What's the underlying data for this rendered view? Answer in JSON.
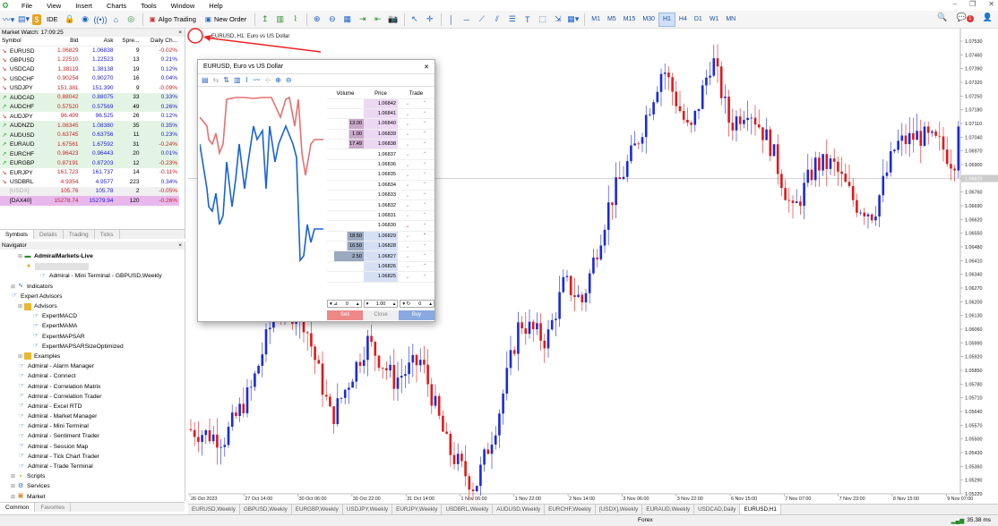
{
  "menu": [
    "File",
    "View",
    "Insert",
    "Charts",
    "Tools",
    "Window",
    "Help"
  ],
  "toolbar": {
    "ide": "IDE",
    "algo": "Algo Trading",
    "neworder": "New Order",
    "timeframes": [
      "M1",
      "M5",
      "M15",
      "M30",
      "H1",
      "H4",
      "D1",
      "W1",
      "MN"
    ],
    "active_tf": "H1",
    "notif_count": "1"
  },
  "market_watch": {
    "title": "Market Watch: 17:09:25",
    "headers": [
      "Symbol",
      "Bid",
      "Ask",
      "Spre...",
      "Daily Ch..."
    ],
    "rows": [
      {
        "dir": "down",
        "sym": "EURUSD",
        "bid": "1.06829",
        "ask": "1.06838",
        "spread": "9",
        "chg": "-0.02%",
        "bg": "#ffffff"
      },
      {
        "dir": "down",
        "sym": "GBPUSD",
        "bid": "1.22510",
        "ask": "1.22523",
        "spread": "13",
        "chg": "0.21%",
        "bg": "#ffffff"
      },
      {
        "dir": "down",
        "sym": "USDCAD",
        "bid": "1.38119",
        "ask": "1.38138",
        "spread": "19",
        "chg": "0.12%",
        "bg": "#ffffff"
      },
      {
        "dir": "down",
        "sym": "USDCHF",
        "bid": "0.90254",
        "ask": "0.90270",
        "spread": "16",
        "chg": "0.04%",
        "bg": "#ffffff"
      },
      {
        "dir": "down",
        "sym": "USDJPY",
        "bid": "151.381",
        "ask": "151.390",
        "spread": "9",
        "chg": "-0.09%",
        "bg": "#ffffff"
      },
      {
        "dir": "up",
        "sym": "AUDCAD",
        "bid": "0.88042",
        "ask": "0.88075",
        "spread": "33",
        "chg": "0.33%",
        "bg": "#e4f4e4"
      },
      {
        "dir": "up",
        "sym": "AUDCHF",
        "bid": "0.57520",
        "ask": "0.57569",
        "spread": "49",
        "chg": "0.26%",
        "bg": "#e4f4e4"
      },
      {
        "dir": "down",
        "sym": "AUDJPY",
        "bid": "96.499",
        "ask": "96.525",
        "spread": "26",
        "chg": "0.12%",
        "bg": "#ffffff"
      },
      {
        "dir": "up",
        "sym": "AUDNZD",
        "bid": "1.08345",
        "ask": "1.08380",
        "spread": "35",
        "chg": "0.35%",
        "bg": "#e4f4e4"
      },
      {
        "dir": "up",
        "sym": "AUDUSD",
        "bid": "0.63745",
        "ask": "0.63756",
        "spread": "11",
        "chg": "0.23%",
        "bg": "#e4f4e4"
      },
      {
        "dir": "up",
        "sym": "EURAUD",
        "bid": "1.67561",
        "ask": "1.67592",
        "spread": "31",
        "chg": "-0.24%",
        "bg": "#e4f4e4"
      },
      {
        "dir": "up",
        "sym": "EURCHF",
        "bid": "0.96423",
        "ask": "0.96443",
        "spread": "20",
        "chg": "0.01%",
        "bg": "#e4f4e4"
      },
      {
        "dir": "up",
        "sym": "EURGBP",
        "bid": "0.87191",
        "ask": "0.87203",
        "spread": "12",
        "chg": "-0.23%",
        "bg": "#e4f4e4"
      },
      {
        "dir": "down",
        "sym": "EURJPY",
        "bid": "161.723",
        "ask": "161.737",
        "spread": "14",
        "chg": "-0.11%",
        "bg": "#ffffff"
      },
      {
        "dir": "down",
        "sym": "USDBRL",
        "bid": "4.9354",
        "ask": "4.9577",
        "spread": "223",
        "chg": "0.34%",
        "bg": "#ffffff"
      },
      {
        "dir": "none",
        "sym": "[USDX]",
        "bid": "105.76",
        "ask": "105.78",
        "spread": "2",
        "chg": "-0.05%",
        "bg": "#f0f0f0"
      },
      {
        "dir": "none",
        "sym": "[DAX40]",
        "bid": "15278.74",
        "ask": "15279.94",
        "spread": "120",
        "chg": "-0.26%",
        "bg": "#e8b8ec"
      }
    ],
    "tabs": [
      "Symbols",
      "Details",
      "Trading",
      "Ticks"
    ]
  },
  "navigator": {
    "title": "Navigator",
    "items": [
      {
        "indent": 2,
        "icon": "server",
        "label": "AdmiralMarkets-Live",
        "bold": true
      },
      {
        "indent": 3,
        "icon": "person",
        "label": ""
      },
      {
        "indent": 5,
        "icon": "ea",
        "label": "Admiral - Mini Terminal - GBPUSD,Weekly"
      },
      {
        "indent": 1,
        "icon": "indicator",
        "label": "Indicators"
      },
      {
        "indent": 1,
        "icon": "ea",
        "label": "Expert Advisors"
      },
      {
        "indent": 2,
        "icon": "folder",
        "label": "Advisors"
      },
      {
        "indent": 4,
        "icon": "ea",
        "label": "ExpertMACD"
      },
      {
        "indent": 4,
        "icon": "ea",
        "label": "ExpertMAMA"
      },
      {
        "indent": 4,
        "icon": "ea",
        "label": "ExpertMAPSAR"
      },
      {
        "indent": 4,
        "icon": "ea",
        "label": "ExpertMAPSARSizeOptimized"
      },
      {
        "indent": 2,
        "icon": "folder",
        "label": "Examples"
      },
      {
        "indent": 2,
        "icon": "ea",
        "label": "Admiral - Alarm Manager"
      },
      {
        "indent": 2,
        "icon": "ea",
        "label": "Admiral - Connect"
      },
      {
        "indent": 2,
        "icon": "ea",
        "label": "Admiral - Correlation Matrix"
      },
      {
        "indent": 2,
        "icon": "ea",
        "label": "Admiral - Correlation Trader"
      },
      {
        "indent": 2,
        "icon": "ea",
        "label": "Admiral - Excel RTD"
      },
      {
        "indent": 2,
        "icon": "ea",
        "label": "Admiral - Market Manager"
      },
      {
        "indent": 2,
        "icon": "ea",
        "label": "Admiral - Mini Terminal"
      },
      {
        "indent": 2,
        "icon": "ea",
        "label": "Admiral - Sentiment Trader"
      },
      {
        "indent": 2,
        "icon": "ea",
        "label": "Admiral - Session Map"
      },
      {
        "indent": 2,
        "icon": "ea",
        "label": "Admiral - Tick Chart Trader"
      },
      {
        "indent": 2,
        "icon": "ea",
        "label": "Admiral - Trade Terminal"
      },
      {
        "indent": 1,
        "icon": "script",
        "label": "Scripts"
      },
      {
        "indent": 1,
        "icon": "service",
        "label": "Services"
      },
      {
        "indent": 1,
        "icon": "market",
        "label": "Market"
      }
    ],
    "tabs": [
      "Common",
      "Favorites"
    ]
  },
  "chart": {
    "header": "EURUSD, H1:  Euro vs US Dollar",
    "price_labels": [
      "1.07530",
      "1.07460",
      "1.07390",
      "1.07320",
      "1.07250",
      "1.07180",
      "1.07110",
      "1.07040",
      "1.06970",
      "1.06900",
      "1.06829",
      "1.06760",
      "1.06690",
      "1.06620",
      "1.06550",
      "1.06480",
      "1.06410",
      "1.06340",
      "1.06270",
      "1.06200",
      "1.06130",
      "1.06060",
      "1.05990",
      "1.05920",
      "1.05850",
      "1.05780",
      "1.05710",
      "1.05640",
      "1.05570",
      "1.05500",
      "1.05430",
      "1.05360",
      "1.05290",
      "1.05220"
    ],
    "current_price": "1.06829",
    "time_labels": [
      "26 Oct 2023",
      "27 Oct 14:00",
      "30 Oct 06:00",
      "30 Oct 22:00",
      "31 Oct 14:00",
      "1 Nov 06:00",
      "1 Nov 22:00",
      "2 Nov 14:00",
      "3 Nov 06:00",
      "3 Nov 22:00",
      "6 Nov 15:00",
      "7 Nov 07:00",
      "7 Nov 23:00",
      "8 Nov 15:00",
      "9 Nov 07:00"
    ],
    "tabs": [
      "EURUSD,Weekly",
      "GBPUSD,Weekly",
      "EURGBP,Weekly",
      "USDJPY,Weekly",
      "EURJPY,Weekly",
      "USDBRL,Weekly",
      "AUDUSD,Weekly",
      "EURCHF,Weekly",
      "[USDX],Weekly",
      "EURAUD,Weekly",
      "USDCAD,Daily",
      "EURUSD,H1"
    ],
    "active_tab": "EURUSD,H1"
  },
  "dom": {
    "title": "EURUSD, Euro vs US Dollar",
    "headers": [
      "Volume",
      "Price",
      "Trade"
    ],
    "rows": [
      {
        "vol": "",
        "price": "1.06842",
        "side": "ask"
      },
      {
        "vol": "",
        "price": "1.06841",
        "side": "ask"
      },
      {
        "vol": "13.00",
        "price": "1.06840",
        "side": "ask"
      },
      {
        "vol": "1.00",
        "price": "1.06839",
        "side": "ask"
      },
      {
        "vol": "17.49",
        "price": "1.06838",
        "side": "ask"
      },
      {
        "vol": "",
        "price": "1.06837",
        "side": "mid"
      },
      {
        "vol": "",
        "price": "1.06836",
        "side": "mid"
      },
      {
        "vol": "",
        "price": "1.06835",
        "side": "mid"
      },
      {
        "vol": "",
        "price": "1.06834",
        "side": "mid"
      },
      {
        "vol": "",
        "price": "1.06833",
        "side": "mid"
      },
      {
        "vol": "",
        "price": "1.06832",
        "side": "mid"
      },
      {
        "vol": "",
        "price": "1.06831",
        "side": "mid"
      },
      {
        "vol": "",
        "price": "1.06830",
        "side": "mid"
      },
      {
        "vol": "18.50",
        "price": "1.06829",
        "side": "bid"
      },
      {
        "vol": "16.50",
        "price": "1.06828",
        "side": "bid"
      },
      {
        "vol": "2.50",
        "price": "1.06827",
        "side": "bid"
      },
      {
        "vol": "",
        "price": "1.06826",
        "side": "bid"
      },
      {
        "vol": "",
        "price": "1.06825",
        "side": "bid"
      }
    ],
    "sl": "0",
    "lot": "1.00",
    "tp": "0",
    "sell": "Sell",
    "close": "Close",
    "buy": "Buy"
  },
  "status": {
    "center": "Forex",
    "right": "35.38 ms"
  }
}
